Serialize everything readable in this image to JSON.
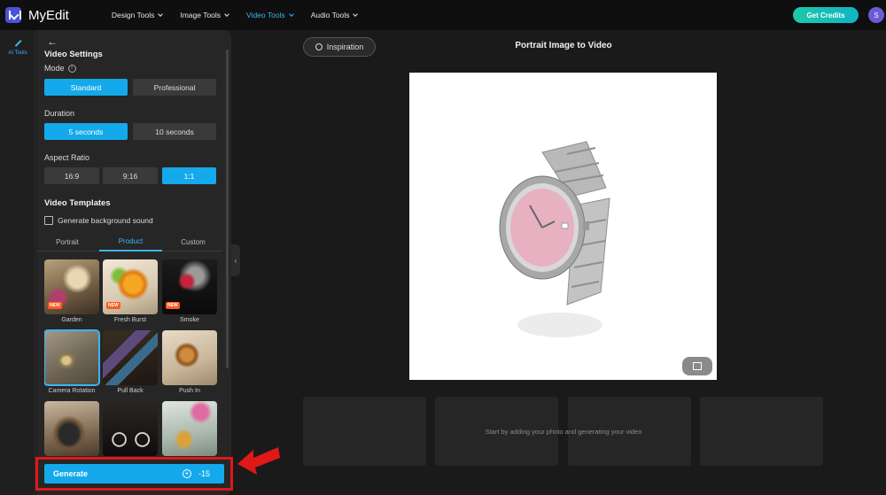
{
  "app": {
    "name": "MyEdit",
    "avatar_initial": "S",
    "get_credits_label": "Get Credits"
  },
  "nav": [
    {
      "label": "Design Tools",
      "active": false
    },
    {
      "label": "Image Tools",
      "active": false
    },
    {
      "label": "Video Tools",
      "active": true
    },
    {
      "label": "Audio Tools",
      "active": false
    }
  ],
  "rail": {
    "all_tools_label": "AI Tools"
  },
  "settings": {
    "title": "Video Settings",
    "mode": {
      "label": "Mode",
      "options": [
        "Standard",
        "Professional"
      ],
      "selected": "Standard"
    },
    "duration": {
      "label": "Duration",
      "options": [
        "5 seconds",
        "10 seconds"
      ],
      "selected": "5 seconds"
    },
    "aspect": {
      "label": "Aspect Ratio",
      "options": [
        "16:9",
        "9:16",
        "1:1"
      ],
      "selected": "1:1"
    },
    "templates_title": "Video Templates",
    "bg_sound_label": "Generate background sound",
    "tabs": [
      "Portrait",
      "Product",
      "Custom"
    ],
    "active_tab": "Product"
  },
  "templates": [
    {
      "label": "Garden",
      "badge": "NEW"
    },
    {
      "label": "Fresh Burst",
      "badge": "NEW"
    },
    {
      "label": "Smoke",
      "badge": "NEW"
    },
    {
      "label": "Camera Rotation",
      "badge": "",
      "selected": true
    },
    {
      "label": "Pull Back",
      "badge": ""
    },
    {
      "label": "Push In",
      "badge": ""
    },
    {
      "label": "",
      "badge": ""
    },
    {
      "label": "",
      "badge": ""
    },
    {
      "label": "",
      "badge": ""
    }
  ],
  "generate": {
    "label": "Generate",
    "cost": "-15"
  },
  "main": {
    "inspiration_label": "Inspiration",
    "title": "Portrait Image to Video",
    "empty_text": "Start by adding your photo and generating your video"
  },
  "colors": {
    "accent": "#14a9ea",
    "credits": "#1ec8a8",
    "highlight": "#e01818"
  }
}
